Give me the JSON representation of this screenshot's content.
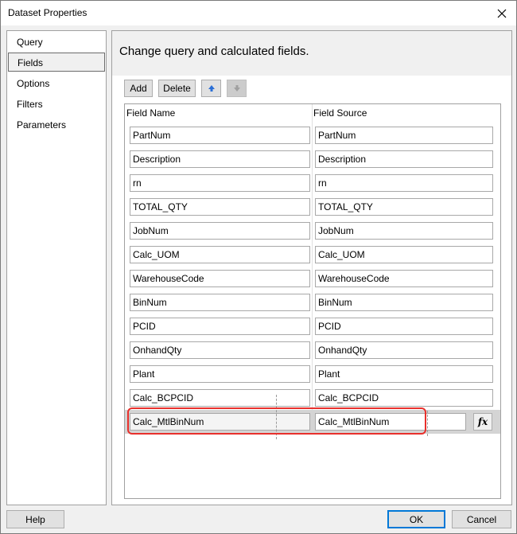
{
  "window": {
    "title": "Dataset Properties"
  },
  "nav": {
    "items": [
      {
        "label": "Query"
      },
      {
        "label": "Fields"
      },
      {
        "label": "Options"
      },
      {
        "label": "Filters"
      },
      {
        "label": "Parameters"
      }
    ],
    "selected": "Fields"
  },
  "main": {
    "heading": "Change query and calculated fields.",
    "toolbar": {
      "add_label": "Add",
      "delete_label": "Delete"
    },
    "columns": {
      "field_name": "Field Name",
      "field_source": "Field Source"
    },
    "rows": [
      {
        "name": "PartNum",
        "source": "PartNum"
      },
      {
        "name": "Description",
        "source": "Description"
      },
      {
        "name": "rn",
        "source": "rn"
      },
      {
        "name": "TOTAL_QTY",
        "source": "TOTAL_QTY"
      },
      {
        "name": "JobNum",
        "source": "JobNum"
      },
      {
        "name": "Calc_UOM",
        "source": "Calc_UOM"
      },
      {
        "name": "WarehouseCode",
        "source": "WarehouseCode"
      },
      {
        "name": "BinNum",
        "source": "BinNum"
      },
      {
        "name": "PCID",
        "source": "PCID"
      },
      {
        "name": "OnhandQty",
        "source": "OnhandQty"
      },
      {
        "name": "Plant",
        "source": "Plant"
      },
      {
        "name": "Calc_BCPCID",
        "source": "Calc_BCPCID"
      },
      {
        "name": "Calc_MtlBinNum",
        "source": "Calc_MtlBinNum"
      }
    ],
    "selected_row": 12,
    "expression_button_label": "fx"
  },
  "footer": {
    "help_label": "Help",
    "ok_label": "OK",
    "cancel_label": "Cancel"
  },
  "colors": {
    "highlight": "#e8302c",
    "focus_border": "#0078d7",
    "up_arrow": "#2b6fd6",
    "down_arrow": "#a0a0a0"
  },
  "icons": [
    "close-icon",
    "up-arrow-icon",
    "down-arrow-icon",
    "expression-icon"
  ]
}
